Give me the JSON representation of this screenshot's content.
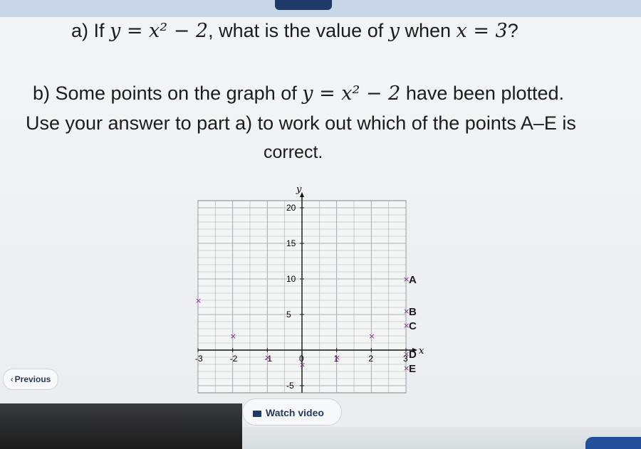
{
  "question": {
    "part_a": {
      "prefix": "a) If ",
      "equation": "y = x² − 2",
      "middle": ", what is the value of ",
      "var_y": "y",
      "when": " when ",
      "condition": "x = 3",
      "suffix": "?"
    },
    "part_b_line1": {
      "prefix": "b) Some points on the graph of ",
      "equation": "y = x² − 2",
      "suffix": " have been plotted."
    },
    "part_b_line2": "Use your answer to part a) to work out which of the points A–E is",
    "part_b_line3": "correct."
  },
  "chart_data": {
    "type": "scatter",
    "xlabel": "x",
    "ylabel": "y",
    "xlim": [
      -3,
      3
    ],
    "ylim": [
      -5,
      20
    ],
    "x_ticks": [
      "-3",
      "-2",
      "-1",
      "0",
      "1",
      "2",
      "3"
    ],
    "y_ticks": [
      "20",
      "15",
      "10",
      "5",
      "-5"
    ],
    "grid": true,
    "points": [
      {
        "label": "",
        "x": -3,
        "y": 7,
        "color": "#8a2a8a"
      },
      {
        "label": "",
        "x": -2,
        "y": 2,
        "color": "#8a2a8a"
      },
      {
        "label": "",
        "x": -1,
        "y": -1,
        "color": "#8a2a8a"
      },
      {
        "label": "",
        "x": 0,
        "y": -2,
        "color": "#8a2a8a"
      },
      {
        "label": "",
        "x": 1,
        "y": -1,
        "color": "#8a2a8a"
      },
      {
        "label": "",
        "x": 2,
        "y": 2,
        "color": "#8a2a8a"
      },
      {
        "label": "A",
        "x": 3,
        "y": 10,
        "color": "#8a2a8a"
      },
      {
        "label": "B",
        "x": 3,
        "y": 5.5,
        "color": "#8a2a8a"
      },
      {
        "label": "C",
        "x": 3,
        "y": 3.5,
        "color": "#8a2a8a"
      },
      {
        "label": "D",
        "x": 3,
        "y": -0.5,
        "color": "#8a2a8a"
      },
      {
        "label": "E",
        "x": 3,
        "y": -2.5,
        "color": "#8a2a8a"
      }
    ]
  },
  "nav": {
    "previous_label": "Previous",
    "previous_icon": "chevron-left-icon"
  },
  "video": {
    "label": "Watch video",
    "icon": "video-icon"
  },
  "colors": {
    "accent": "#1f3a66",
    "marker": "#8a2a8a",
    "button": "#214f9a"
  }
}
